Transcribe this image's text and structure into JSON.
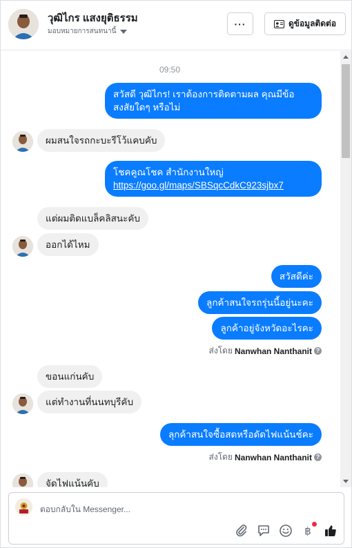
{
  "header": {
    "name": "วุฒิไกร แสงยุติธรรม",
    "assign_label": "มอบหมายการสนทนานี้",
    "more_label": "···",
    "contact_button": "ดูข้อมูลติดต่อ"
  },
  "thread": {
    "timestamp": "09:50",
    "messages": [
      {
        "dir": "out",
        "text": "สวัสดี วุฒิไกร! เราต้องการติดตามผล คุณมีข้อ",
        "text2": "สงสัยใดๆ หรือไม่"
      },
      {
        "dir": "in",
        "text": "ผมสนใจรถกะบะรีโว้แคบคับ"
      },
      {
        "dir": "out",
        "text": "โชคคูณโชค สำนักงานใหญ่",
        "link": "https://goo.gl/maps/SBSqcCdkC923sjbx7"
      },
      {
        "dir": "in",
        "text": "แต่ผมติดแบล็คลิสนะคับ"
      },
      {
        "dir": "in",
        "text": "ออกได้ไหม"
      },
      {
        "dir": "out",
        "text": "สวัสดีค่ะ"
      },
      {
        "dir": "out",
        "text": "ลูกค้าสนใจรถรุ่นนี้อยู่นะคะ"
      },
      {
        "dir": "out",
        "text": "ลูกค้าอยู่จังหวัดอะไรคะ"
      },
      {
        "dir": "in",
        "text": "ขอนแก่นคับ"
      },
      {
        "dir": "in",
        "text": "แต่ทำงานที่นนทบุรีคับ"
      },
      {
        "dir": "out",
        "text": "ลุกค้าสนใจซื้อสดหรือดัดไฟแน้นช์คะ"
      },
      {
        "dir": "in",
        "text": "จัดไฟแน้นคับ"
      }
    ],
    "sent_by_prefix": "ส่งโดย",
    "sent_by_name": "Nanwhan Nanthanit",
    "help_glyph": "?"
  },
  "composer": {
    "placeholder": "ตอบกลับใน Messenger..."
  },
  "colors": {
    "accent": "#0a7cff",
    "incoming_bubble": "#f0f0f0"
  }
}
